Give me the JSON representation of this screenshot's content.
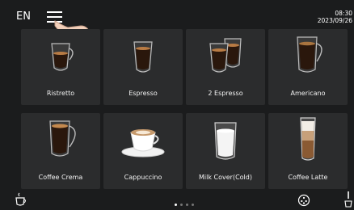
{
  "header": {
    "language": "EN",
    "time": "08:30",
    "date": "2023/09/26"
  },
  "drinks": [
    {
      "label": "Ristretto",
      "icon": "ristretto-cup-icon"
    },
    {
      "label": "Espresso",
      "icon": "espresso-cup-icon"
    },
    {
      "label": "2 Espresso",
      "icon": "two-espresso-cups-icon"
    },
    {
      "label": "Americano",
      "icon": "americano-mug-icon"
    },
    {
      "label": "Coffee Crema",
      "icon": "coffee-crema-mug-icon"
    },
    {
      "label": "Cappuccino",
      "icon": "cappuccino-cup-icon"
    },
    {
      "label": "Milk Cover(Cold)",
      "icon": "milk-glass-icon"
    },
    {
      "label": "Coffee Latte",
      "icon": "latte-glass-icon"
    }
  ],
  "pagination": {
    "current": 1,
    "total": 4
  },
  "footer": {
    "left_icon": "cup-steam-icon",
    "center_icon": "settings-dial-icon",
    "right_icon": "hot-water-icon"
  }
}
